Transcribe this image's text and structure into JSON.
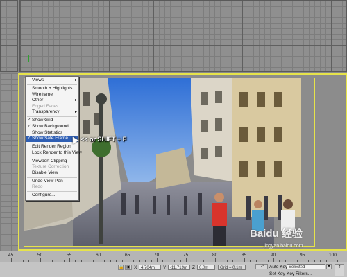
{
  "menu": {
    "items": [
      {
        "label": "Views",
        "check": false,
        "submenu": true,
        "disabled": false
      },
      {
        "sep": true
      },
      {
        "label": "Smooth + Highlights",
        "check": false,
        "submenu": false,
        "disabled": false
      },
      {
        "label": "Wireframe",
        "check": false,
        "submenu": false,
        "disabled": false
      },
      {
        "label": "Other",
        "check": false,
        "submenu": true,
        "disabled": false
      },
      {
        "label": "Edged Faces",
        "check": false,
        "submenu": false,
        "disabled": true
      },
      {
        "label": "Transparency",
        "check": false,
        "submenu": true,
        "disabled": false
      },
      {
        "sep": true
      },
      {
        "label": "Show Grid",
        "check": true,
        "submenu": false,
        "disabled": false
      },
      {
        "label": "Show Background",
        "check": true,
        "submenu": false,
        "disabled": false
      },
      {
        "label": "Show Statistics",
        "check": false,
        "submenu": false,
        "disabled": false
      },
      {
        "label": "Show Safe Frame",
        "check": true,
        "submenu": false,
        "disabled": false,
        "selected": true
      },
      {
        "sep": true
      },
      {
        "label": "Edit Render Region",
        "check": false,
        "submenu": false,
        "disabled": false
      },
      {
        "label": "Lock Render to this View",
        "check": false,
        "submenu": false,
        "disabled": false
      },
      {
        "sep": true
      },
      {
        "label": "Viewport Clipping",
        "check": false,
        "submenu": false,
        "disabled": false
      },
      {
        "label": "Texture Correction",
        "check": false,
        "submenu": false,
        "disabled": true
      },
      {
        "label": "Disable View",
        "check": false,
        "submenu": false,
        "disabled": false
      },
      {
        "sep": true
      },
      {
        "label": "Undo View Pan",
        "check": false,
        "submenu": false,
        "disabled": false
      },
      {
        "label": "Redo",
        "check": false,
        "submenu": false,
        "disabled": true
      },
      {
        "sep": true
      },
      {
        "label": "Configure...",
        "check": false,
        "submenu": false,
        "disabled": false
      }
    ]
  },
  "annotation": "<< or   SHIFT + F",
  "ruler": {
    "ticks": [
      "45",
      "50",
      "55",
      "60",
      "65",
      "70",
      "75",
      "80",
      "85",
      "90",
      "95",
      "100"
    ]
  },
  "status": {
    "x_label": "X",
    "x_value": "4.704m",
    "y_label": "Y",
    "y_value": "-11.719m",
    "z_label": "Z",
    "z_value": "0.0m",
    "grid": "Grid = 0.1m",
    "auto_key": "Auto Key",
    "auto_key_mode": "Selected",
    "set_key": "Set Key",
    "key_filters": "Key Filters..."
  },
  "watermark": {
    "text": "Baidu 经验",
    "url": "jingyan.baidu.com"
  },
  "colors": {
    "safe_frame": "#e6e34a",
    "menu_highlight": "#2f5fb4",
    "sky": "#3f79d6"
  }
}
